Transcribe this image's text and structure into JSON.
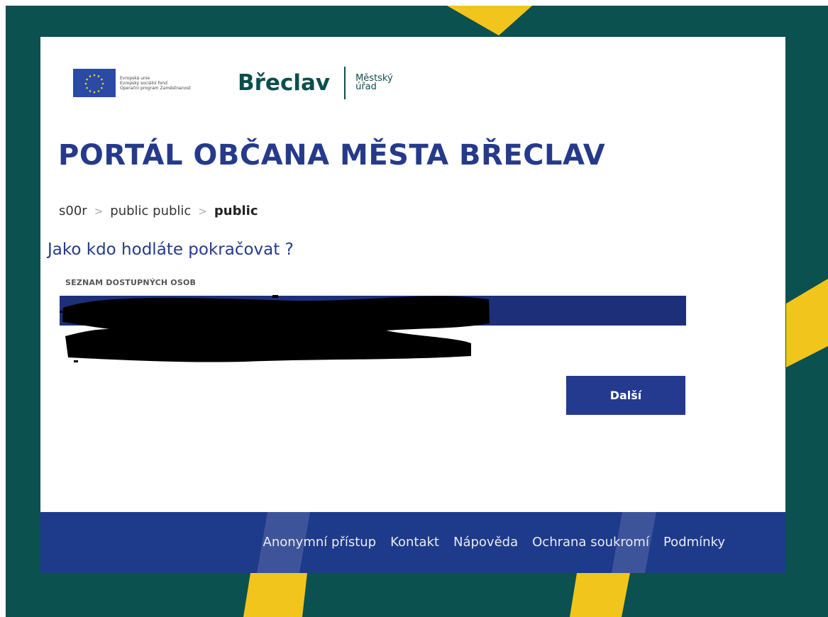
{
  "colors": {
    "frame_bg": "#0b5150",
    "accent_yellow": "#f2c51c",
    "brand_blue": "#233a8f",
    "footer_bg": "#1e3a8a",
    "selected_row": "#1e2f7a"
  },
  "logos": {
    "eu_text_lines": [
      "Evropská unie",
      "Evropský sociální fond",
      "Operační program Zaměstnanost"
    ],
    "city_name": "Břeclav",
    "office_line1": "Městský",
    "office_line2": "úřad"
  },
  "page_title": "PORTÁL OBČANA MĚSTA BŘECLAV",
  "breadcrumb": {
    "items": [
      "s00r",
      "public public",
      "public"
    ],
    "separator": ">"
  },
  "question": "Jako kdo hodláte pokračovat ?",
  "persons_list": {
    "label": "SEZNAM DOSTUPNÝCH OSOB"
  },
  "next_button": "Další",
  "footer": {
    "links": [
      "Anonymní přístup",
      "Kontakt",
      "Nápověda",
      "Ochrana soukromí",
      "Podmínky"
    ]
  }
}
